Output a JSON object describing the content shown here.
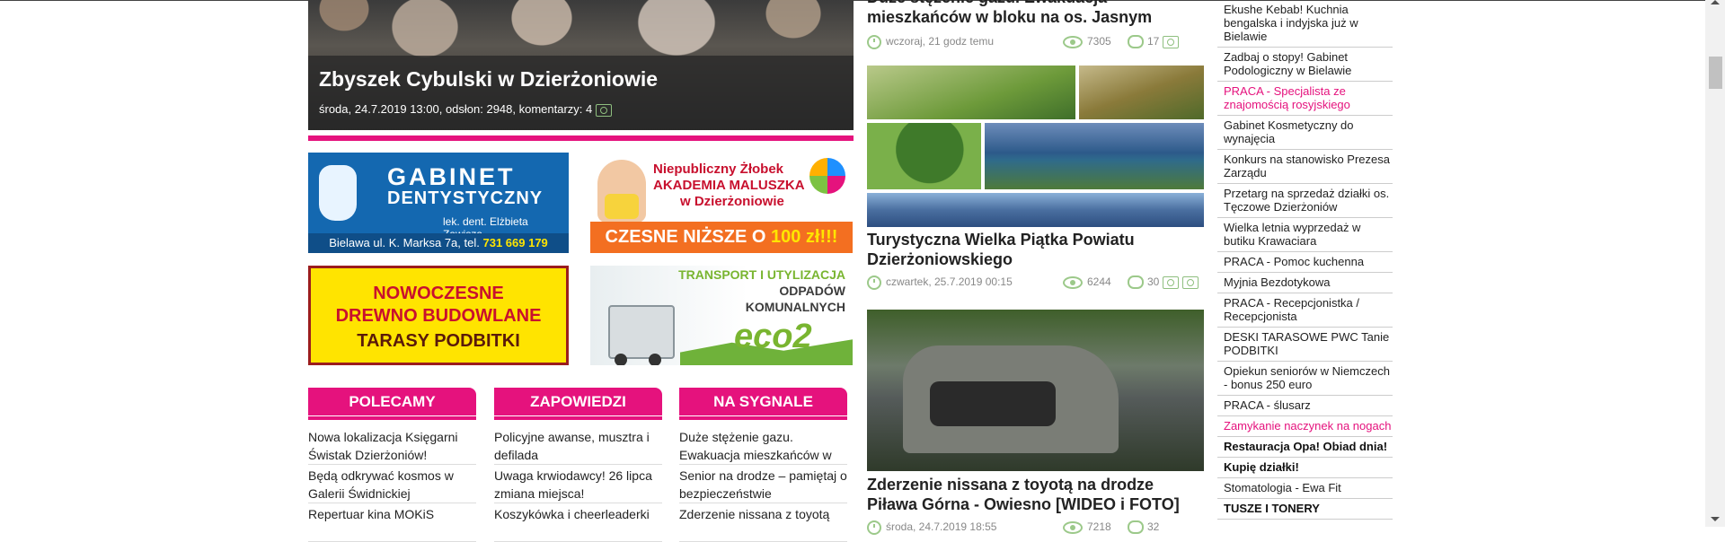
{
  "hero": {
    "title": "Zbyszek Cybulski w Dzierżoniowie",
    "meta": "środa, 24.7.2019 13:00, odsłon: 2948, komentarzy: 4"
  },
  "ads": {
    "dentist": {
      "line1": "GABINET",
      "line2": "DENTYSTYCZNY",
      "line3": "lek. dent. Elżbieta Zawisza",
      "address": "Bielawa ul. K. Marksa 7a, tel.",
      "phone": "731 669 179"
    },
    "nursery": {
      "line1": "Niepubliczny Żłobek",
      "line2": "AKADEMIA MALUSZKA",
      "line3": "w Dzierżoniowie",
      "promo_a": "CZESNE NIŻSZE O ",
      "promo_b": "100 zł!!!"
    },
    "wood": {
      "line1": "NOWOCZESNE",
      "line2": "DREWNO BUDOWLANE",
      "line3": "TARASY PODBITKI"
    },
    "eco": {
      "line1": "TRANSPORT I UTYLIZACJA",
      "line2": "ODPADÓW",
      "line3": "KOMUNALNYCH",
      "logo_a": "eco",
      "logo_b": "2"
    }
  },
  "columns": [
    {
      "header": "POLECAMY",
      "items": [
        "Nowa lokalizacja Księgarni Świstak Dzierżoniów!",
        "Będą odkrywać kosmos w Galerii Świdnickiej",
        "Repertuar kina MOKiS"
      ]
    },
    {
      "header": "ZAPOWIEDZI",
      "items": [
        "Policyjne awanse, musztra i defilada",
        "Uwaga krwiodawcy! 26 lipca zmiana miejsca!",
        "Koszykówka i cheerleaderki"
      ]
    },
    {
      "header": "NA SYGNALE",
      "items": [
        "Duże stężenie gazu. Ewakuacja mieszkańców w",
        "Senior na drodze – pamiętaj o bezpieczeństwie",
        "Zderzenie nissana z toyotą"
      ]
    }
  ],
  "articles": [
    {
      "title": "Duże stężenie gazu. Ewakuacja mieszkańców w bloku na os. Jasnym",
      "date": "wczoraj, 21 godz temu",
      "views": "7305",
      "comments": "17"
    },
    {
      "title": "Turystyczna Wielka Piątka Powiatu Dzierżoniowskiego",
      "date": "czwartek, 25.7.2019 00:15",
      "views": "6244",
      "comments": "30"
    },
    {
      "title": "Zderzenie nissana z toyotą na drodze Piława Górna - Owiesno [WIDEO i FOTO]",
      "date": "środa, 24.7.2019 18:55",
      "views": "7218",
      "comments": "32"
    }
  ],
  "sidebar": [
    "Ekushe Kebab! Kuchnia bengalska i indyjska już w Bielawie",
    "Zadbaj o stopy! Gabinet Podologiczny w Bielawie",
    "PRACA - Specjalista ze znajomością rosyjskiego",
    "Gabinet Kosmetyczny do wynajęcia",
    "Konkurs na stanowisko Prezesa Zarządu",
    "Przetarg na sprzedaż działki os. Tęczowe Dzierżoniów",
    "Wielka letnia wyprzedaż w butiku Krawaciara",
    "PRACA - Pomoc kuchenna",
    "Myjnia Bezdotykowa",
    "PRACA - Recepcjonistka / Recepcjonista",
    "DESKI TARASOWE PWC Tanie PODBITKI",
    "Opiekun seniorów w Niemczech - bonus 250 euro",
    "PRACA - ślusarz",
    "Zamykanie naczynek na nogach",
    "Restauracja Opa! Obiad dnia!",
    "Kupię działki!",
    "Stomatologia - Ewa Fit",
    "TUSZE I TONERY"
  ],
  "colors": {
    "accent": "#e5127d",
    "icon_green": "#9cc98a"
  }
}
